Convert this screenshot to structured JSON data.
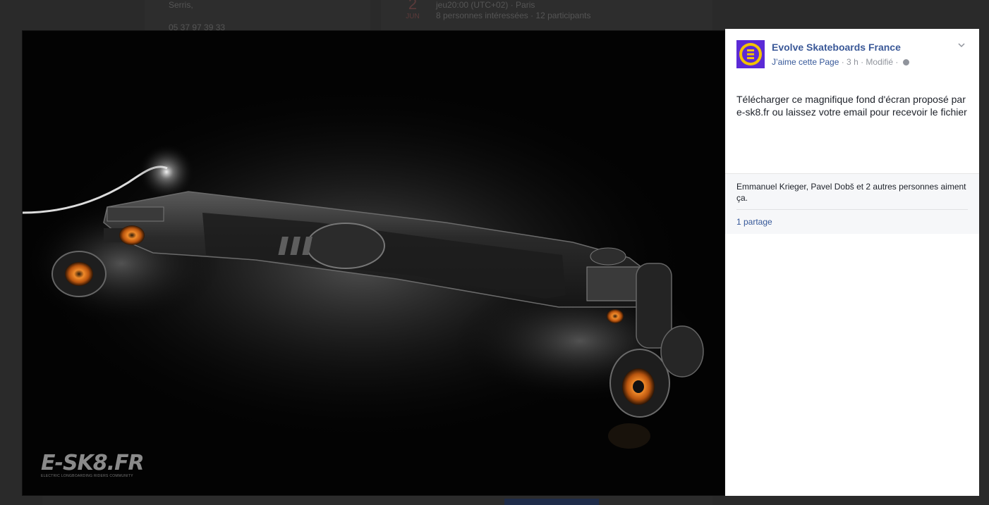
{
  "background": {
    "address_line": "Serris,",
    "phone": "05 37 97 39 33",
    "event_day": "2",
    "event_month": "JUN",
    "event_time": "jeu20:00 (UTC+02) · Paris",
    "event_stats": "8 personnes intéressées · 12 participants"
  },
  "photo": {
    "watermark_logo": "E-SK8.FR",
    "watermark_tagline": "ELECTRIC LONGBOARDING RIDERS COMMUNITY"
  },
  "post": {
    "page_name": "Evolve Skateboards France",
    "like_page_label": "J’aime cette Page",
    "meta_rest": " · 3 h · Modifié · ",
    "text": "Télécharger ce magnifique fond d'écran proposé par e-sk8.fr ou laissez votre email pour recevoir le fichier",
    "likes_summary": "Emmanuel Krieger, Pavel Dobš et 2 autres personnes aiment ça.",
    "shares": "1 partage"
  },
  "colors": {
    "link_blue": "#365899",
    "page_name_blue": "#3b5998",
    "avatar_purple": "#5b2ad6",
    "avatar_yellow": "#f2c300",
    "wheel_orange": "#e8721c"
  },
  "icons": [
    "chevron-down-icon",
    "globe-icon",
    "evolve-logo-icon"
  ]
}
